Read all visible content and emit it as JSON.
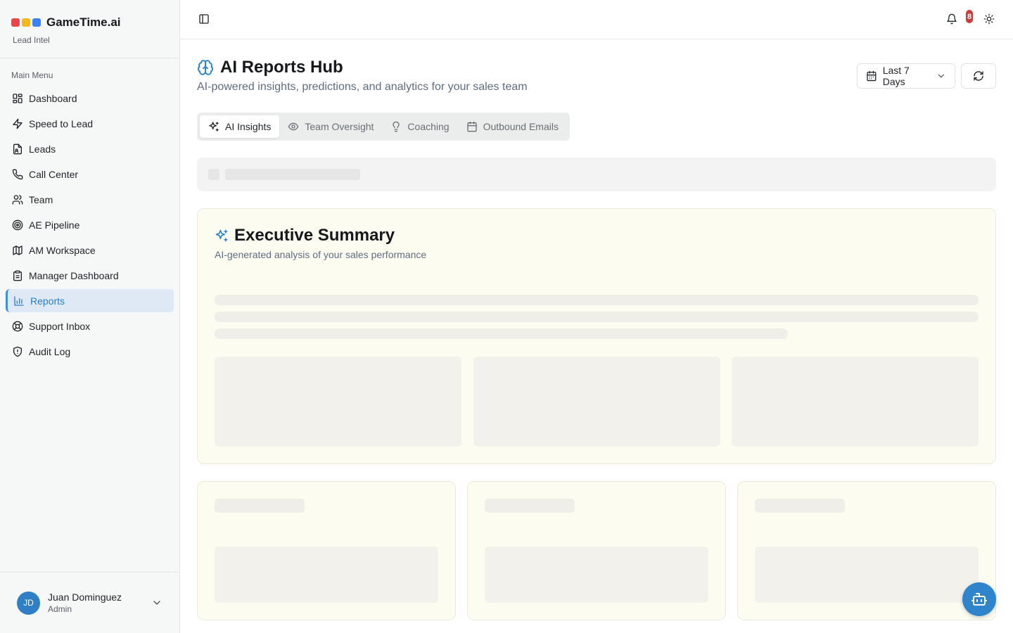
{
  "brand": {
    "name": "GameTime.ai",
    "subtitle": "Lead Intel",
    "dot_colors": [
      "#e5484d",
      "#f2b81b",
      "#3b82f6"
    ]
  },
  "sidebar": {
    "section_label": "Main Menu",
    "items": [
      {
        "label": "Dashboard",
        "icon": "dashboard-icon"
      },
      {
        "label": "Speed to Lead",
        "icon": "lightning-icon"
      },
      {
        "label": "Leads",
        "icon": "leads-icon"
      },
      {
        "label": "Call Center",
        "icon": "phone-icon"
      },
      {
        "label": "Team",
        "icon": "users-icon"
      },
      {
        "label": "AE Pipeline",
        "icon": "target-icon"
      },
      {
        "label": "AM Workspace",
        "icon": "map-icon"
      },
      {
        "label": "Manager Dashboard",
        "icon": "clipboard-icon"
      },
      {
        "label": "Reports",
        "icon": "bar-chart-icon",
        "active": true
      },
      {
        "label": "Support Inbox",
        "icon": "lifebuoy-icon"
      },
      {
        "label": "Audit Log",
        "icon": "shield-icon"
      }
    ]
  },
  "user": {
    "initials": "JD",
    "name": "Juan Dominguez",
    "role": "Admin"
  },
  "topbar": {
    "notification_count": "8"
  },
  "page": {
    "title": "AI Reports Hub",
    "subtitle": "AI-powered insights, predictions, and analytics for your sales team",
    "date_range": "Last 7 Days"
  },
  "tabs": [
    {
      "label": "AI Insights",
      "icon": "sparkles-icon",
      "active": true
    },
    {
      "label": "Team Oversight",
      "icon": "eye-icon"
    },
    {
      "label": "Coaching",
      "icon": "lightbulb-icon"
    },
    {
      "label": "Outbound Emails",
      "icon": "calendar-icon"
    }
  ],
  "executive_summary": {
    "title": "Executive Summary",
    "subtitle": "AI-generated analysis of your sales performance"
  },
  "colors": {
    "accent": "#2f85cc",
    "active_nav_bg": "#dfe9f5",
    "badge": "#c93c3c",
    "card_bg": "#fdfcf1"
  }
}
